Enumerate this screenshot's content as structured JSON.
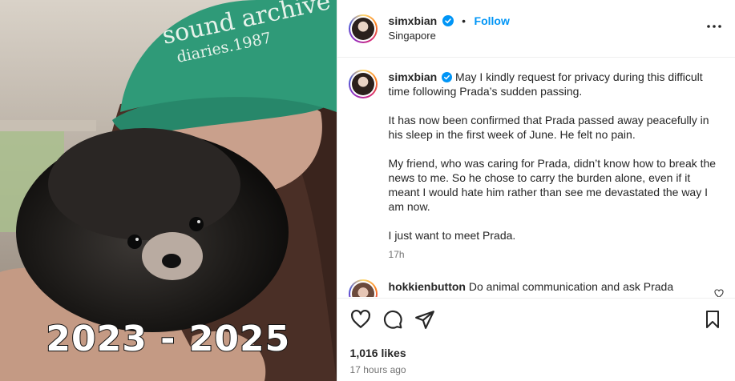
{
  "media": {
    "hat_text_line1": "sound archive",
    "hat_text_line2": "diaries.1987",
    "overlay_text": "2023 - 2025"
  },
  "header": {
    "username": "simxbian",
    "separator": "•",
    "follow_label": "Follow",
    "location": "Singapore",
    "more_icon": "more-horizontal-icon"
  },
  "caption": {
    "username": "simxbian",
    "paragraphs": [
      "May I kindly request for privacy during this difficult time following Prada’s sudden passing.",
      "It has now been confirmed that Prada passed away peacefully in his sleep in the first week of June. He felt no pain.",
      "My friend, who was caring for Prada, didn’t know how to break the news to me. So he chose to carry the burden alone, even if it meant I would hate him rather than see me devastated the way I am now.",
      "I just want to meet Prada."
    ],
    "time": "17h"
  },
  "comment": {
    "username": "hokkienbutton",
    "text": "Do animal communication and ask Prada"
  },
  "actions": {
    "likes": "1,016 likes",
    "posted_ago": "17 hours ago",
    "icons": [
      "heart-icon",
      "comment-icon",
      "share-icon",
      "bookmark-icon"
    ]
  },
  "colors": {
    "accent": "#0095f6",
    "verified": "#0095f6",
    "hat": "#2f9a78"
  }
}
